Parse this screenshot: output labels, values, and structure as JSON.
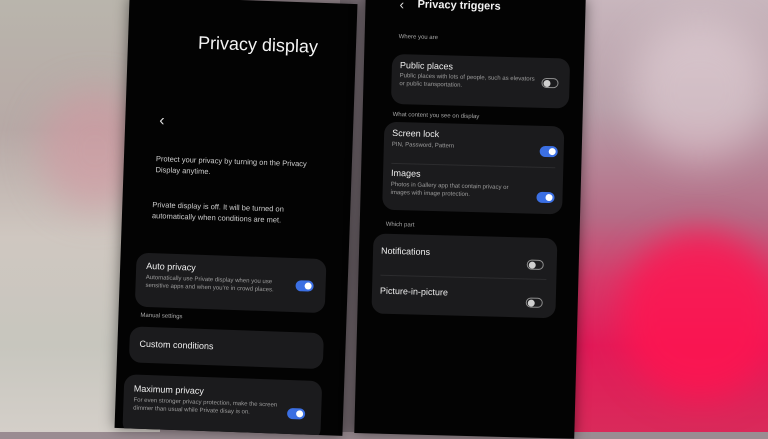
{
  "left_screen": {
    "title": "Privacy display",
    "description": "Protect your privacy by turning on the Privacy Display anytime.",
    "status_text": "Private display is off. It will be turned on automatically when conditions are met.",
    "auto_privacy": {
      "title": "Auto privacy",
      "subtitle": "Automatically use Private display when you use sensitive apps and when you're in crowd places.",
      "enabled": true
    },
    "manual_settings_label": "Manual settings",
    "custom_conditions": "Custom conditions",
    "maximum_privacy": {
      "title": "Maximum privacy",
      "subtitle": "For even stronger privacy protection, make the screen dimmer than usual while Private disay is on.",
      "enabled": true
    }
  },
  "right_screen": {
    "title": "Privacy triggers",
    "where_label": "Where you are",
    "public_places": {
      "title": "Public places",
      "subtitle": "Public places with lots of people, such as elevators or public transportation.",
      "enabled": false
    },
    "content_label": "What content you see on display",
    "screen_lock": {
      "title": "Screen lock",
      "subtitle": "PIN, Password, Pattern",
      "enabled": true
    },
    "images": {
      "title": "Images",
      "subtitle": "Photos in Gallery app that contain privacy or images with image protection.",
      "enabled": true
    },
    "which_part_label": "Which part",
    "notifications": {
      "title": "Notifications",
      "enabled": false
    },
    "picture_in_picture": {
      "title": "Picture-in-picture",
      "enabled": false
    }
  },
  "colors": {
    "toggle_on": "#3b6fe3",
    "card": "#1b1b1d",
    "screen": "#030303"
  },
  "icons": {
    "back": "chevron-left-icon"
  }
}
